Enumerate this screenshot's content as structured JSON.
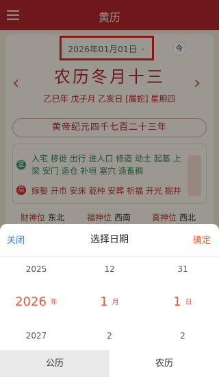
{
  "header": {
    "title": "黄历"
  },
  "date_selector": {
    "value": "2026年01月01日",
    "chevron": "⌄"
  },
  "today_button": {
    "label": "今"
  },
  "nav": {
    "prev_arrow": "‹",
    "next_arrow": "›"
  },
  "lunar": {
    "title": "农历冬月十三",
    "ganzhi": "乙巳年 戊子月 乙亥日 [属蛇] 星期四",
    "era": "黄帝纪元四千七百二十三年"
  },
  "yiji": {
    "yi_badge": "宜",
    "yi_text": "入宅 移徙 出行 进人口 修造 动土 起基 上梁 安门 造仓 补垣 塞穴 造畜稠",
    "ji_badge": "忌",
    "ji_text": "嫁娶 开市 安床 栽种 安葬 祈福 开光 掘井"
  },
  "gods": [
    {
      "label": "财神位",
      "value": "东北"
    },
    {
      "label": "福神位",
      "value": "西南"
    },
    {
      "label": "喜神位",
      "value": "西北"
    }
  ],
  "picker": {
    "close_label": "关闭",
    "title": "选择日期",
    "confirm_label": "确定",
    "year": {
      "prev": "2025",
      "current": "2026",
      "unit": "年",
      "next": "2027"
    },
    "month": {
      "prev": "12",
      "current": "1",
      "unit": "月",
      "next": "2"
    },
    "day": {
      "prev": "31",
      "current": "1",
      "unit": "日",
      "next": "2"
    }
  },
  "tabs": [
    {
      "label": "公历",
      "active": true
    },
    {
      "label": "农历",
      "active": false
    }
  ],
  "colors": {
    "brand": "#b3282d",
    "accent": "#e9523a",
    "link": "#2d7ed8",
    "highlight_box": "#e5231f"
  }
}
